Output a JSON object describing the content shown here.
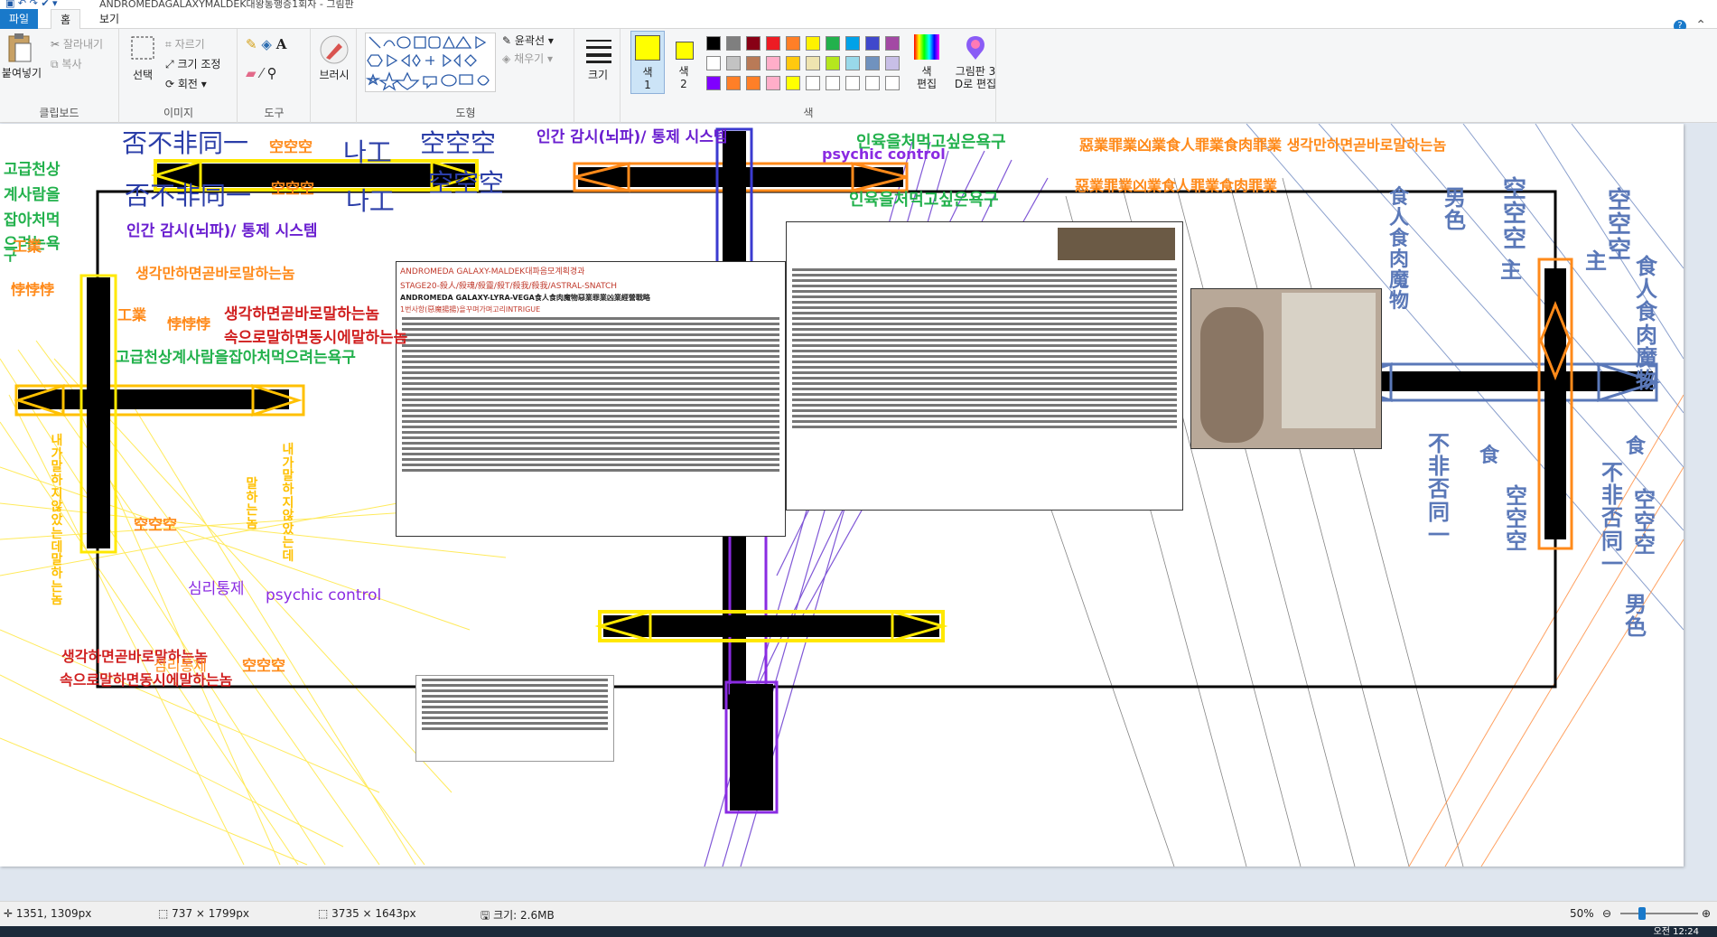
{
  "window": {
    "title": "ANDROMEDAGALAXYMALDEK대왕통행증1회자 - 그림판"
  },
  "ribbon_tabs": [
    "파일",
    "홈",
    "보기"
  ],
  "clipboard": {
    "paste": "붙여넣기",
    "cut": "잘라내기",
    "copy": "복사",
    "group": "클립보드"
  },
  "image": {
    "select": "선택",
    "crop": "자르기",
    "resize": "크기 조정",
    "rotate": "회전",
    "group": "이미지"
  },
  "tools": {
    "group": "도구"
  },
  "brushes": {
    "label": "브러시"
  },
  "shapes": {
    "outline": "윤곽선",
    "fill": "채우기",
    "group": "도형"
  },
  "size": {
    "label": "크기"
  },
  "colors": {
    "color1": "색\n1",
    "color2": "색\n2",
    "edit": "색\n편집",
    "paint3d": "그림판 3\nD로 편집",
    "group": "색",
    "primary": "#ffff00",
    "secondary": "#ffff00",
    "palette": [
      "#000000",
      "#7f7f7f",
      "#880015",
      "#ed1c24",
      "#ff7f27",
      "#fff200",
      "#22b14c",
      "#00a2e8",
      "#3f48cc",
      "#a349a4",
      "#ffffff",
      "#c3c3c3",
      "#b97a57",
      "#ffaec9",
      "#ffc90e",
      "#efe4b0",
      "#b5e61d",
      "#99d9ea",
      "#7092be",
      "#c8bfe7",
      "#7f00ff",
      "#ff7f27",
      "#ff7f27",
      "#ffaec9",
      "#ffff00",
      "#ffffff",
      "#ffffff",
      "#ffffff",
      "#ffffff",
      "#ffffff"
    ]
  },
  "canvas_text": {
    "t1": "否不非同一",
    "t2": "空空空",
    "t3": "나工",
    "t4": "空空空",
    "t5": "인간 감시(뇌파)/ 통제 시스템",
    "t6": "psychic control",
    "t7": "인육을처먹고싶은욕구",
    "t8": "惡業罪業凶業食人罪業食肉罪業  생각만하면곧바로말하는놈",
    "t9": "고급천상",
    "t10": "계사람을",
    "t11": "잡아처먹",
    "t12": "으려는욕",
    "t13": "구",
    "t14": "否不非同一",
    "t15": "空空空",
    "t16": "나工",
    "t17": "空空空",
    "t18": "인간 감시(뇌파)/ 통제 시스템",
    "t19": "工業",
    "t20": "생각만하면곧바로말하는놈",
    "t21": "悖悖悖",
    "t22": "工業",
    "t23": "悖悖悖",
    "t24": "생각하면곧바로말하는놈",
    "t25": "속으로말하면동시에말하는놈",
    "t26": "고급천상계사람을잡아처먹으려는욕구",
    "t27": "인육을처먹고싶은욕구",
    "t28": "惡業罪業凶業食人罪業食肉罪業",
    "t29": "空空空",
    "t30": "심리통제",
    "t31": "psychic control",
    "t32": "생각하면곧바로말하는놈",
    "t33": "속으로말하면동시에말하는놈",
    "t34": "심리통제",
    "t35": "空空空",
    "t36": "空空空",
    "t37": "男色",
    "t38": "食人食肉魔物",
    "t39": "主",
    "t40": "空空空",
    "t41": "食人食肉魔物",
    "t42": "主",
    "t43": "不非否同一",
    "t44": "食",
    "t45": "空空空",
    "t46": "食",
    "t47": "不非否同一",
    "t48": "空空空",
    "t49": "男色",
    "t50": "내가말하지않았는데말하는놈",
    "t51": "말하는놈",
    "t52": "내가말하지않았는데",
    "t53": "ANDROMEDA GALAXY-MALDEK대파음모계획경과",
    "t54": "STAGE20-殺人/殺魂/殺靈/殺T/殺我/殺我/ASTRAL-SNATCH",
    "t55": "ANDROMEDA GALAXY-LYRA-VEGA食人食肉魔物惡業罪業凶業經營戰略",
    "t56": "1번사항(惡魔揚揚)을꾸며가며고리INTRIGUE"
  },
  "status": {
    "cursor": "1351, 1309px",
    "selection": "737 × 1799px",
    "canvas_size": "3735 × 1643px",
    "file_size": "크기: 2.6MB",
    "zoom": "50%"
  },
  "taskbar": {
    "clock": "오전 12:24"
  }
}
